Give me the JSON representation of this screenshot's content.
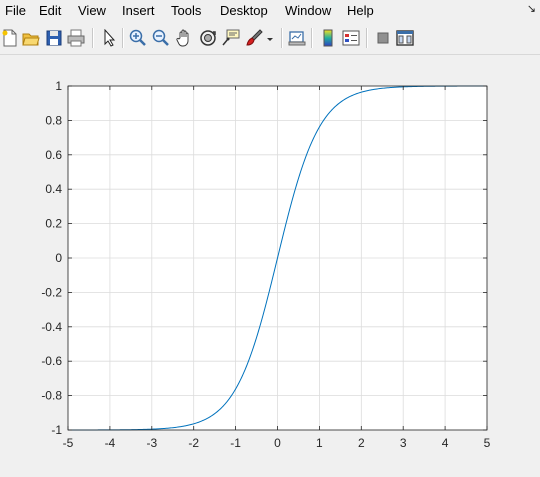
{
  "menubar": {
    "items": [
      {
        "label": "File"
      },
      {
        "label": "Edit"
      },
      {
        "label": "View"
      },
      {
        "label": "Insert"
      },
      {
        "label": "Tools"
      },
      {
        "label": "Desktop"
      },
      {
        "label": "Window"
      },
      {
        "label": "Help"
      }
    ],
    "dock_arrow": "↘"
  },
  "toolbar": {
    "icons": [
      "new-figure-icon",
      "open-file-icon",
      "save-icon",
      "print-icon",
      "edit-plot-icon",
      "zoom-in-icon",
      "zoom-out-icon",
      "pan-icon",
      "rotate-3d-icon",
      "data-cursor-icon",
      "brush-icon",
      "link-plot-icon",
      "insert-colorbar-icon",
      "insert-legend-icon",
      "hide-plot-tools-icon",
      "show-plot-tools-icon"
    ]
  },
  "colors": {
    "line": "#0072bd",
    "grid": "#dcdcdc",
    "axes": "#262626"
  },
  "chart_data": {
    "type": "line",
    "function_shape": "tanh",
    "x": [
      -5,
      -4.5,
      -4,
      -3.5,
      -3,
      -2.75,
      -2.5,
      -2.25,
      -2,
      -1.75,
      -1.5,
      -1.25,
      -1,
      -0.75,
      -0.5,
      -0.25,
      0,
      0.25,
      0.5,
      0.75,
      1,
      1.25,
      1.5,
      1.75,
      2,
      2.25,
      2.5,
      2.75,
      3,
      3.5,
      4,
      4.5,
      5
    ],
    "y": [
      -0.9999,
      -0.9998,
      -0.9993,
      -0.9982,
      -0.9951,
      -0.9918,
      -0.9866,
      -0.978,
      -0.964,
      -0.9414,
      -0.9051,
      -0.8483,
      -0.7616,
      -0.6351,
      -0.4621,
      -0.2449,
      0,
      0.2449,
      0.4621,
      0.6351,
      0.7616,
      0.8483,
      0.9051,
      0.9414,
      0.964,
      0.978,
      0.9866,
      0.9918,
      0.9951,
      0.9982,
      0.9993,
      0.9998,
      0.9999
    ],
    "xlim": [
      -5,
      5
    ],
    "ylim": [
      -1,
      1
    ],
    "xticks": [
      "-5",
      "-4",
      "-3",
      "-2",
      "-1",
      "0",
      "1",
      "2",
      "3",
      "4",
      "5"
    ],
    "yticks": [
      "-1",
      "-0.8",
      "-0.6",
      "-0.4",
      "-0.2",
      "0",
      "0.2",
      "0.4",
      "0.6",
      "0.8",
      "1"
    ],
    "xtick_values": [
      -5,
      -4,
      -3,
      -2,
      -1,
      0,
      1,
      2,
      3,
      4,
      5
    ],
    "ytick_values": [
      -1,
      -0.8,
      -0.6,
      -0.4,
      -0.2,
      0,
      0.2,
      0.4,
      0.6,
      0.8,
      1
    ],
    "grid": true,
    "title": "",
    "xlabel": "",
    "ylabel": ""
  }
}
